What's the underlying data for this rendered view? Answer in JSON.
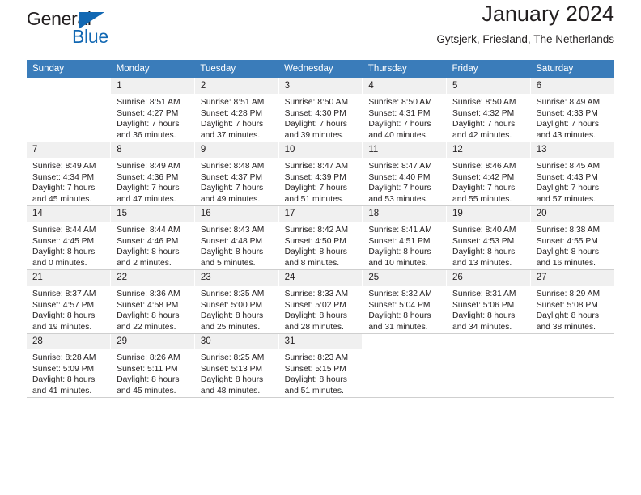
{
  "brand": {
    "word_one": "General",
    "word_two": "Blue",
    "triangle_icon": "triangle-icon",
    "accent_color": "#1268b3"
  },
  "header": {
    "title": "January 2024",
    "subtitle": "Gytsjerk, Friesland, The Netherlands"
  },
  "theme": {
    "header_row_bg": "#3a7cba",
    "daynum_bg": "#f0f0f0",
    "grid_line": "#cfcfcf",
    "text": "#231f20"
  },
  "columns": [
    "Sunday",
    "Monday",
    "Tuesday",
    "Wednesday",
    "Thursday",
    "Friday",
    "Saturday"
  ],
  "weeks": [
    [
      {
        "day": "",
        "lines": []
      },
      {
        "day": "1",
        "lines": [
          "Sunrise: 8:51 AM",
          "Sunset: 4:27 PM",
          "Daylight: 7 hours",
          "and 36 minutes."
        ]
      },
      {
        "day": "2",
        "lines": [
          "Sunrise: 8:51 AM",
          "Sunset: 4:28 PM",
          "Daylight: 7 hours",
          "and 37 minutes."
        ]
      },
      {
        "day": "3",
        "lines": [
          "Sunrise: 8:50 AM",
          "Sunset: 4:30 PM",
          "Daylight: 7 hours",
          "and 39 minutes."
        ]
      },
      {
        "day": "4",
        "lines": [
          "Sunrise: 8:50 AM",
          "Sunset: 4:31 PM",
          "Daylight: 7 hours",
          "and 40 minutes."
        ]
      },
      {
        "day": "5",
        "lines": [
          "Sunrise: 8:50 AM",
          "Sunset: 4:32 PM",
          "Daylight: 7 hours",
          "and 42 minutes."
        ]
      },
      {
        "day": "6",
        "lines": [
          "Sunrise: 8:49 AM",
          "Sunset: 4:33 PM",
          "Daylight: 7 hours",
          "and 43 minutes."
        ]
      }
    ],
    [
      {
        "day": "7",
        "lines": [
          "Sunrise: 8:49 AM",
          "Sunset: 4:34 PM",
          "Daylight: 7 hours",
          "and 45 minutes."
        ]
      },
      {
        "day": "8",
        "lines": [
          "Sunrise: 8:49 AM",
          "Sunset: 4:36 PM",
          "Daylight: 7 hours",
          "and 47 minutes."
        ]
      },
      {
        "day": "9",
        "lines": [
          "Sunrise: 8:48 AM",
          "Sunset: 4:37 PM",
          "Daylight: 7 hours",
          "and 49 minutes."
        ]
      },
      {
        "day": "10",
        "lines": [
          "Sunrise: 8:47 AM",
          "Sunset: 4:39 PM",
          "Daylight: 7 hours",
          "and 51 minutes."
        ]
      },
      {
        "day": "11",
        "lines": [
          "Sunrise: 8:47 AM",
          "Sunset: 4:40 PM",
          "Daylight: 7 hours",
          "and 53 minutes."
        ]
      },
      {
        "day": "12",
        "lines": [
          "Sunrise: 8:46 AM",
          "Sunset: 4:42 PM",
          "Daylight: 7 hours",
          "and 55 minutes."
        ]
      },
      {
        "day": "13",
        "lines": [
          "Sunrise: 8:45 AM",
          "Sunset: 4:43 PM",
          "Daylight: 7 hours",
          "and 57 minutes."
        ]
      }
    ],
    [
      {
        "day": "14",
        "lines": [
          "Sunrise: 8:44 AM",
          "Sunset: 4:45 PM",
          "Daylight: 8 hours",
          "and 0 minutes."
        ]
      },
      {
        "day": "15",
        "lines": [
          "Sunrise: 8:44 AM",
          "Sunset: 4:46 PM",
          "Daylight: 8 hours",
          "and 2 minutes."
        ]
      },
      {
        "day": "16",
        "lines": [
          "Sunrise: 8:43 AM",
          "Sunset: 4:48 PM",
          "Daylight: 8 hours",
          "and 5 minutes."
        ]
      },
      {
        "day": "17",
        "lines": [
          "Sunrise: 8:42 AM",
          "Sunset: 4:50 PM",
          "Daylight: 8 hours",
          "and 8 minutes."
        ]
      },
      {
        "day": "18",
        "lines": [
          "Sunrise: 8:41 AM",
          "Sunset: 4:51 PM",
          "Daylight: 8 hours",
          "and 10 minutes."
        ]
      },
      {
        "day": "19",
        "lines": [
          "Sunrise: 8:40 AM",
          "Sunset: 4:53 PM",
          "Daylight: 8 hours",
          "and 13 minutes."
        ]
      },
      {
        "day": "20",
        "lines": [
          "Sunrise: 8:38 AM",
          "Sunset: 4:55 PM",
          "Daylight: 8 hours",
          "and 16 minutes."
        ]
      }
    ],
    [
      {
        "day": "21",
        "lines": [
          "Sunrise: 8:37 AM",
          "Sunset: 4:57 PM",
          "Daylight: 8 hours",
          "and 19 minutes."
        ]
      },
      {
        "day": "22",
        "lines": [
          "Sunrise: 8:36 AM",
          "Sunset: 4:58 PM",
          "Daylight: 8 hours",
          "and 22 minutes."
        ]
      },
      {
        "day": "23",
        "lines": [
          "Sunrise: 8:35 AM",
          "Sunset: 5:00 PM",
          "Daylight: 8 hours",
          "and 25 minutes."
        ]
      },
      {
        "day": "24",
        "lines": [
          "Sunrise: 8:33 AM",
          "Sunset: 5:02 PM",
          "Daylight: 8 hours",
          "and 28 minutes."
        ]
      },
      {
        "day": "25",
        "lines": [
          "Sunrise: 8:32 AM",
          "Sunset: 5:04 PM",
          "Daylight: 8 hours",
          "and 31 minutes."
        ]
      },
      {
        "day": "26",
        "lines": [
          "Sunrise: 8:31 AM",
          "Sunset: 5:06 PM",
          "Daylight: 8 hours",
          "and 34 minutes."
        ]
      },
      {
        "day": "27",
        "lines": [
          "Sunrise: 8:29 AM",
          "Sunset: 5:08 PM",
          "Daylight: 8 hours",
          "and 38 minutes."
        ]
      }
    ],
    [
      {
        "day": "28",
        "lines": [
          "Sunrise: 8:28 AM",
          "Sunset: 5:09 PM",
          "Daylight: 8 hours",
          "and 41 minutes."
        ]
      },
      {
        "day": "29",
        "lines": [
          "Sunrise: 8:26 AM",
          "Sunset: 5:11 PM",
          "Daylight: 8 hours",
          "and 45 minutes."
        ]
      },
      {
        "day": "30",
        "lines": [
          "Sunrise: 8:25 AM",
          "Sunset: 5:13 PM",
          "Daylight: 8 hours",
          "and 48 minutes."
        ]
      },
      {
        "day": "31",
        "lines": [
          "Sunrise: 8:23 AM",
          "Sunset: 5:15 PM",
          "Daylight: 8 hours",
          "and 51 minutes."
        ]
      },
      {
        "day": "",
        "lines": []
      },
      {
        "day": "",
        "lines": []
      },
      {
        "day": "",
        "lines": []
      }
    ]
  ]
}
